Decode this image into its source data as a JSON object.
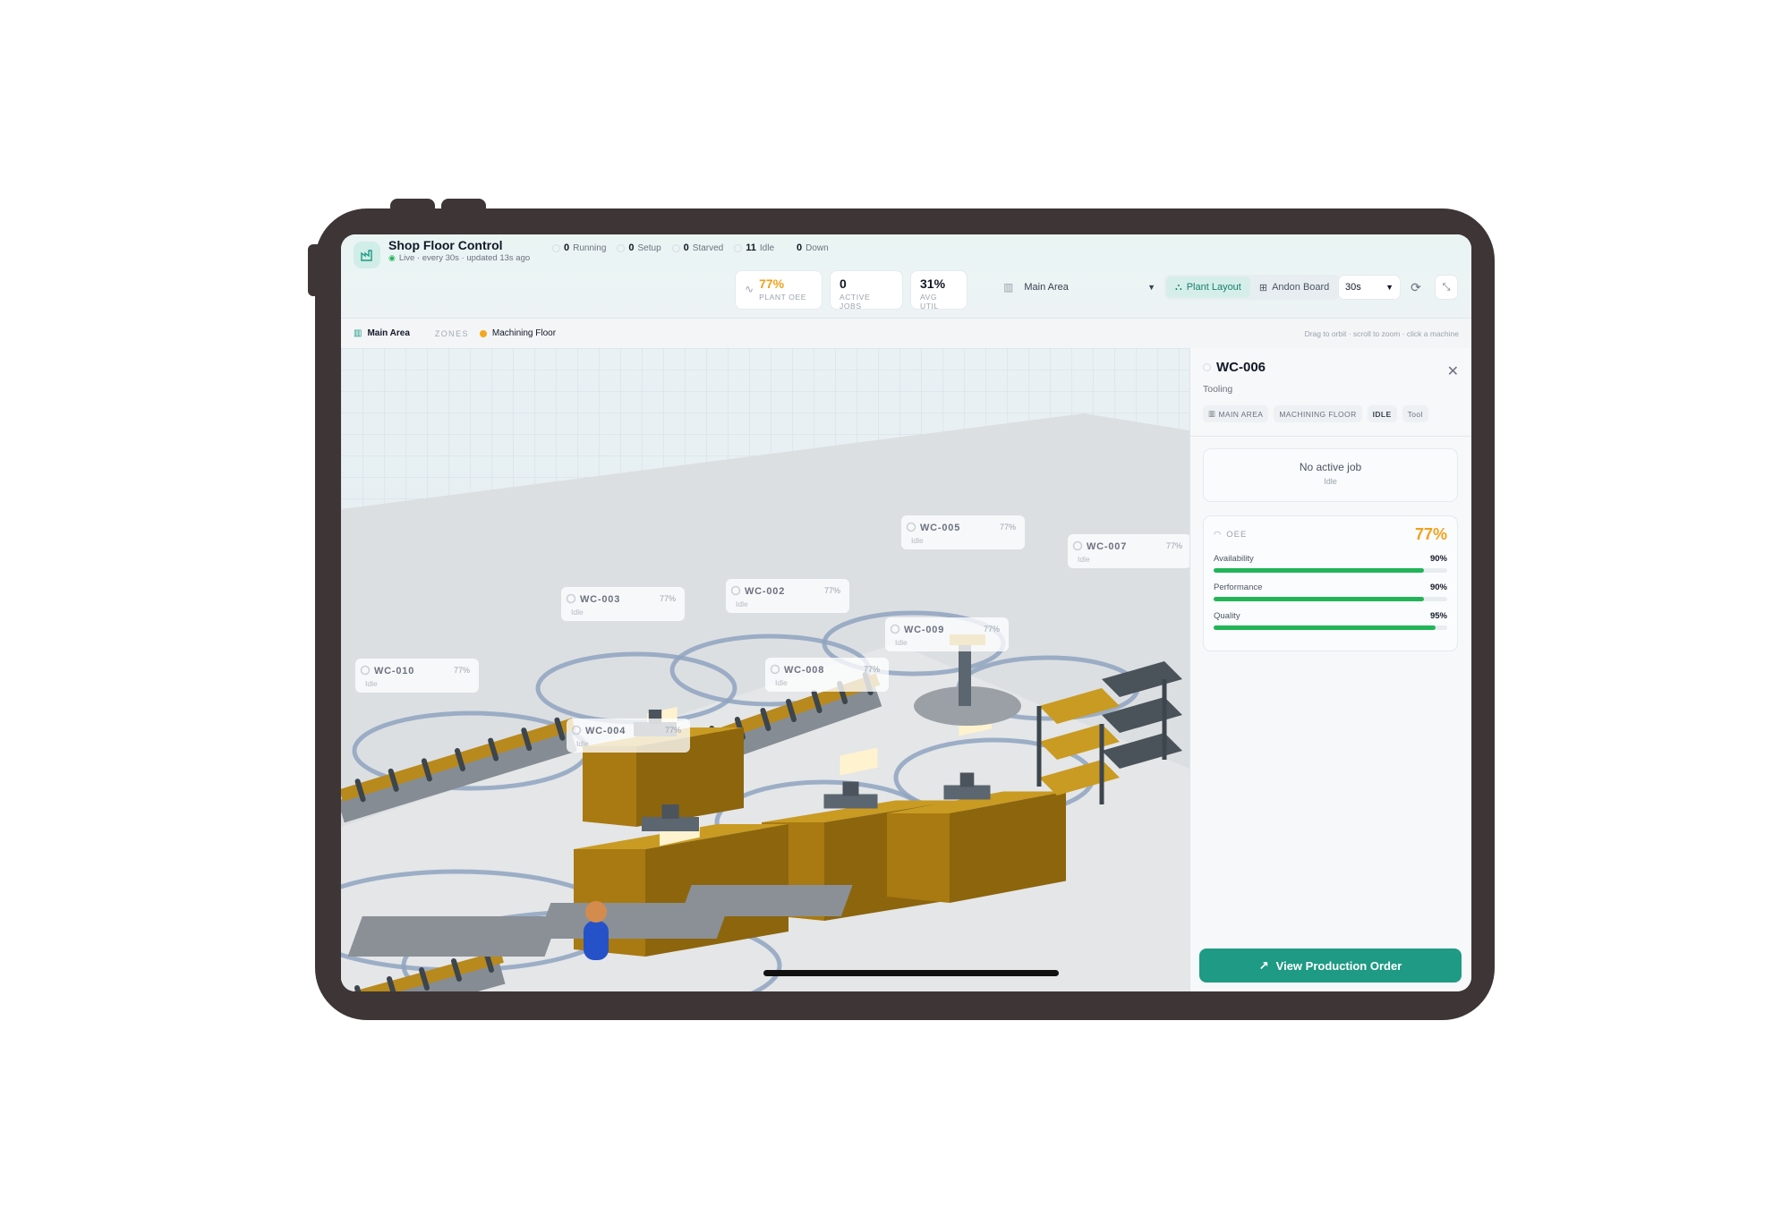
{
  "app": {
    "title": "Shop Floor Control",
    "live_text": "Live · every 30s · updated 13s ago"
  },
  "status_counts": [
    {
      "count": "0",
      "label": "Running",
      "color": "#22b558"
    },
    {
      "count": "0",
      "label": "Setup",
      "color": "#f1a81d"
    },
    {
      "count": "0",
      "label": "Starved",
      "color": "#3b82f6"
    },
    {
      "count": "11",
      "label": "Idle",
      "color": "#9aa3ad"
    },
    {
      "count": "0",
      "label": "Down",
      "color": "#ef4444"
    }
  ],
  "kpis": {
    "plant_oee": {
      "value": "77%",
      "label": "PLANT OEE"
    },
    "active_jobs": {
      "value": "0",
      "label": "ACTIVE JOBS"
    },
    "avg_util": {
      "value": "31%",
      "label": "AVG UTIL"
    }
  },
  "area_select": {
    "value": "Main Area"
  },
  "view_tabs": {
    "plant_layout": "Plant Layout",
    "andon_board": "Andon Board"
  },
  "interval": {
    "value": "30s"
  },
  "breadcrumb": {
    "area": "Main Area",
    "zones_label": "ZONES",
    "zone": "Machining Floor"
  },
  "hint": "Drag to orbit · scroll to zoom · click a machine",
  "machines": [
    {
      "id": "WC-010",
      "pct": "77%",
      "status": "Idle"
    },
    {
      "id": "WC-003",
      "pct": "77%",
      "status": "Idle"
    },
    {
      "id": "WC-002",
      "pct": "77%",
      "status": "Idle"
    },
    {
      "id": "WC-005",
      "pct": "77%",
      "status": "Idle"
    },
    {
      "id": "WC-007",
      "pct": "77%",
      "status": "Idle"
    },
    {
      "id": "WC-009",
      "pct": "77%",
      "status": "Idle"
    },
    {
      "id": "WC-008",
      "pct": "77%",
      "status": "Idle"
    },
    {
      "id": "WC-004",
      "pct": "77%",
      "status": "Idle"
    }
  ],
  "panel": {
    "title": "WC-006",
    "subtitle": "Tooling",
    "tags": {
      "area": "MAIN AREA",
      "zone": "MACHINING FLOOR",
      "state": "IDLE",
      "type": "Tool"
    },
    "no_job": {
      "title": "No active job",
      "sub": "Idle"
    },
    "oee": {
      "label": "OEE",
      "value": "77%"
    },
    "metrics": [
      {
        "label": "Availability",
        "value": "90%",
        "fraction": 0.9
      },
      {
        "label": "Performance",
        "value": "90%",
        "fraction": 0.9
      },
      {
        "label": "Quality",
        "value": "95%",
        "fraction": 0.95
      }
    ],
    "cta": "View Production Order"
  },
  "colors": {
    "accent": "#1f9a84",
    "oee": "#f0a21b",
    "bar": "#22b558",
    "machine": "#b8891c"
  }
}
